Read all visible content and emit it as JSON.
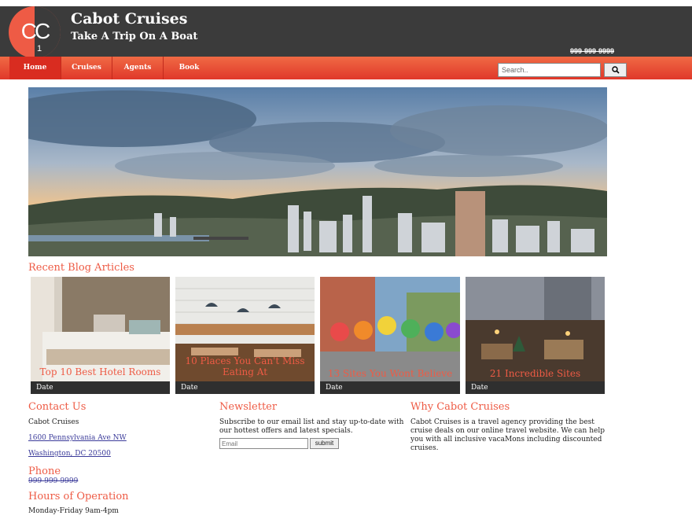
{
  "header": {
    "logo": {
      "letters": "CC",
      "number": "1"
    },
    "title": "Cabot Cruises",
    "tagline": "Take A Trip On A Boat",
    "phone": "999-999-9999"
  },
  "nav": {
    "items": [
      {
        "label": "Home",
        "active": true
      },
      {
        "label": "Cruises",
        "active": false
      },
      {
        "label": "Agents",
        "active": false
      },
      {
        "label": "Book",
        "active": false
      }
    ],
    "search_placeholder": "Search..",
    "search_icon": "search-icon"
  },
  "blog": {
    "heading": "Recent Blog Articles",
    "articles": [
      {
        "title": "Top 10 Best Hotel Rooms",
        "date": "Date"
      },
      {
        "title": "10 Places You Can't Miss Eating At",
        "date": "Date"
      },
      {
        "title": "13 Sites You Wont Believe",
        "date": "Date"
      },
      {
        "title": "21 Incredible Sites",
        "date": "Date"
      }
    ]
  },
  "contact": {
    "heading": "Contact Us",
    "company": "Cabot Cruises",
    "address_line1": "1600 Pennsylvania Ave NW",
    "address_line2": "Washington, DC 20500",
    "phone_heading": "Phone",
    "phone": "999-999-9999",
    "hours_heading": "Hours of Operation",
    "hours": "Monday-Friday 9am-4pm"
  },
  "newsletter": {
    "heading": "Newsletter",
    "text": "Subscribe to our email list and stay up-to-date with our hottest offers and latest specials.",
    "email_placeholder": "Email",
    "submit_label": "submit"
  },
  "why": {
    "heading": "Why Cabot Cruises",
    "text": "Cabot Cruises is a travel agency providing the best cruise deals on our online travel website. We can help you with all inclusive vacaMons including discounted cruises."
  },
  "colors": {
    "accent": "#ee5b45",
    "header_bg": "#3b3b3b",
    "nav_bg": "#e0382a"
  }
}
